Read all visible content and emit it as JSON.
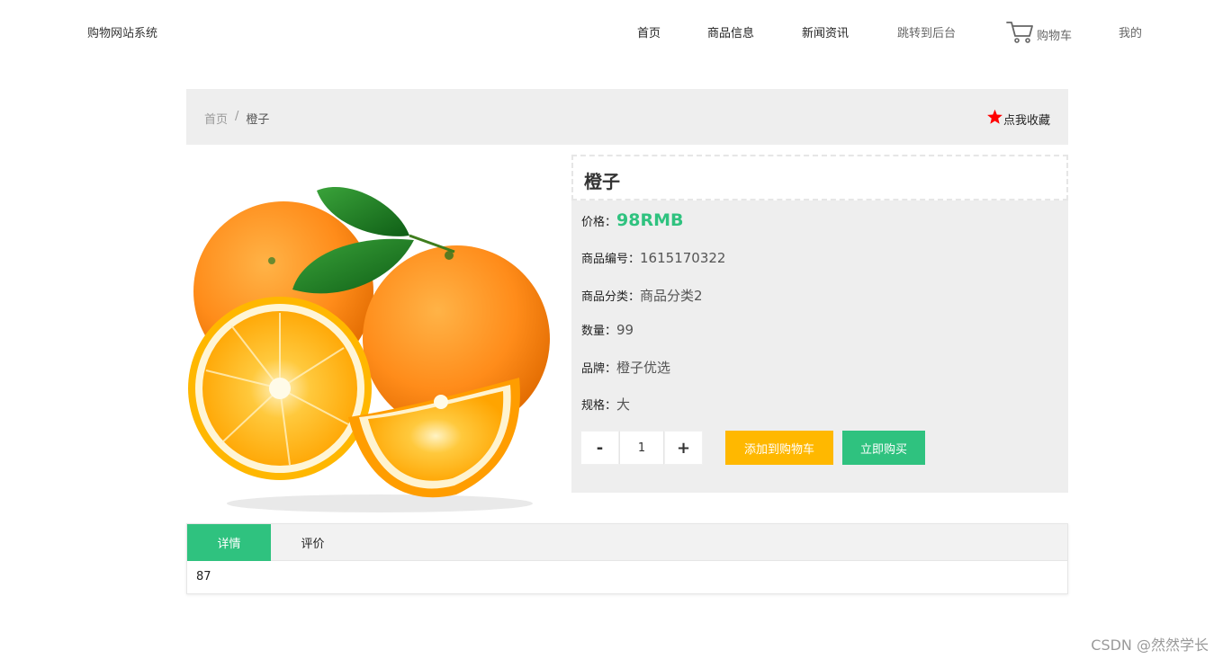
{
  "header": {
    "site_title": "购物网站系统",
    "nav": [
      {
        "label": "首页"
      },
      {
        "label": "商品信息"
      },
      {
        "label": "新闻资讯"
      },
      {
        "label": "跳转到后台"
      }
    ],
    "cart_label": "购物车",
    "mine_label": "我的"
  },
  "breadcrumb": {
    "home": "首页",
    "separator": "/",
    "current": "橙子"
  },
  "favorite": {
    "label": "点我收藏",
    "icon": "star-icon",
    "color": "#ff0000"
  },
  "product": {
    "name": "橙子",
    "price_label": "价格：",
    "price": "98RMB",
    "code_label": "商品编号：",
    "code": "1615170322",
    "category_label": "商品分类：",
    "category": "商品分类2",
    "quantity_label": "数量：",
    "quantity": "99",
    "brand_label": "品牌：",
    "brand": "橙子优选",
    "spec_label": "规格：",
    "spec": "大",
    "image": "oranges-photo"
  },
  "purchase": {
    "minus": "-",
    "plus": "+",
    "amount": "1",
    "add_to_cart": "添加到购物车",
    "buy_now": "立即购买"
  },
  "tabs": {
    "items": [
      {
        "label": "详情",
        "active": true
      },
      {
        "label": "评价",
        "active": false
      }
    ],
    "content": "87"
  },
  "watermark": "CSDN @然然学长",
  "colors": {
    "accent": "#2fc27f",
    "warning": "#ffb800"
  }
}
